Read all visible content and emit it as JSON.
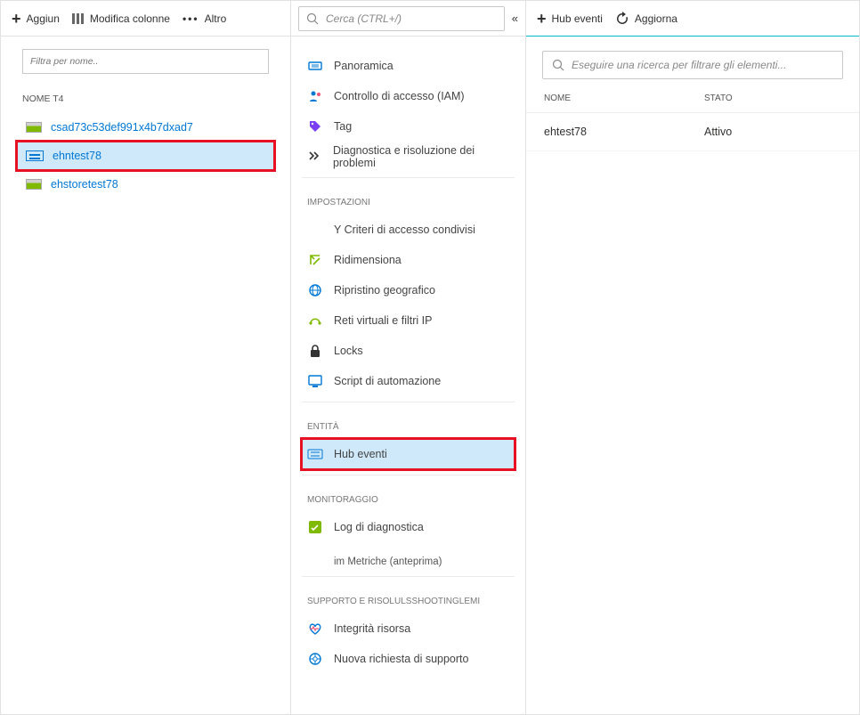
{
  "left": {
    "toolbar": {
      "add": "Aggiun",
      "edit_cols": "Modifica colonne",
      "more": "Altro"
    },
    "filter_placeholder": "Filtra per nome..",
    "col_header": "NOME T4",
    "items": [
      {
        "label": "csad73c53def991x4b7dxad7",
        "icon": "storage",
        "selected": false,
        "highlight": false
      },
      {
        "label": "ehntest78",
        "icon": "eventhub",
        "selected": true,
        "highlight": true
      },
      {
        "label": "ehstoretest78",
        "icon": "storage",
        "selected": false,
        "highlight": false
      }
    ]
  },
  "mid": {
    "search_placeholder": "Cerca (CTRL+/)",
    "groups": {
      "general": [
        {
          "label": "Panoramica",
          "icon": "overview-icon"
        },
        {
          "label": "Controllo di accesso (IAM)",
          "icon": "iam-icon"
        },
        {
          "label": "Tag",
          "icon": "tag-icon"
        },
        {
          "label": "Diagnostica e risoluzione dei problemi",
          "icon": "diag-icon"
        }
      ],
      "settings_label": "IMPOSTAZIONI",
      "settings": [
        {
          "label": "Y Criteri di accesso condivisi",
          "icon": "key-icon",
          "textonly": true
        },
        {
          "label": "Ridimensiona",
          "icon": "resize-icon"
        },
        {
          "label": "Ripristino geografico",
          "icon": "geo-icon"
        },
        {
          "label": "Reti virtuali e filtri IP",
          "icon": "vnet-icon"
        },
        {
          "label": "Locks",
          "icon": "lock-icon"
        },
        {
          "label": "Script di automazione",
          "icon": "script-icon"
        }
      ],
      "entities_label": "ENTITÀ",
      "entities": [
        {
          "label": "Hub eventi",
          "icon": "eventhub-icon",
          "selected": true,
          "highlight": true
        }
      ],
      "monitoring_label": "MONITORAGGIO",
      "monitoring": [
        {
          "label": "Log di diagnostica",
          "icon": "logs-icon"
        }
      ],
      "monitoring_sub": "im Metriche (anteprima)",
      "support_label": "SUPPORTO E RISOLULSSHOOTINGLEMI",
      "support": [
        {
          "label": "Integrità risorsa",
          "icon": "health-icon"
        },
        {
          "label": "Nuova richiesta di supporto",
          "icon": "support-icon"
        }
      ]
    }
  },
  "right": {
    "toolbar": {
      "add_hub": "Hub eventi",
      "refresh": "Aggiorna"
    },
    "search_placeholder": "Eseguire una ricerca per filtrare gli elementi...",
    "headers": {
      "name": "NOME",
      "state": "STATO"
    },
    "rows": [
      {
        "name": "ehtest78",
        "state": "Attivo"
      }
    ]
  },
  "icons": {
    "overview": "#0078d4",
    "tag": "#7b3ff2",
    "diag": "#333",
    "resize": "#7fba00",
    "geo": "#0078d4",
    "vnet": "#7fba00",
    "lock": "#333",
    "script": "#0078d4",
    "eventhub": "#0078d4",
    "logs": "#7fba00",
    "health": "#0078d4",
    "support": "#0078d4",
    "iam": "#0078d4"
  }
}
